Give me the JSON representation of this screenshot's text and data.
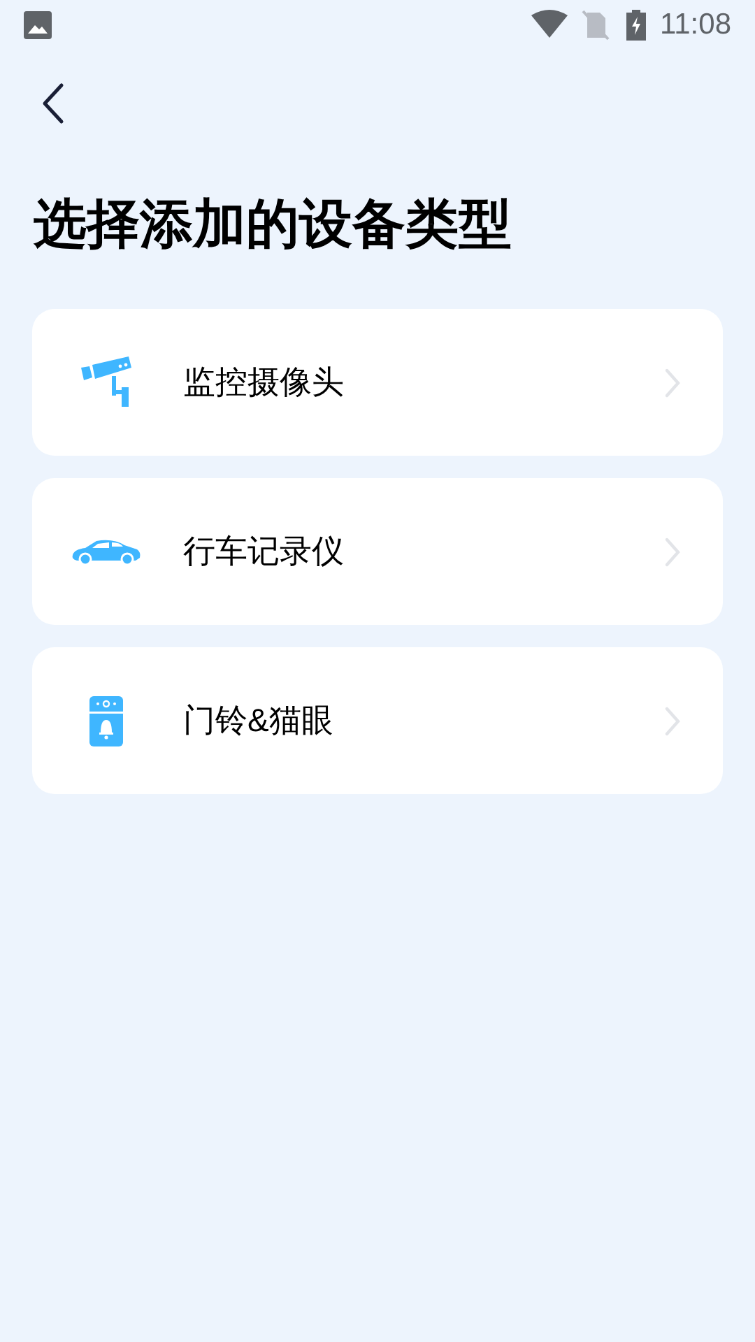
{
  "status_bar": {
    "time": "11:08"
  },
  "title": "选择添加的设备类型",
  "devices": [
    {
      "kind": "camera",
      "label": "监控摄像头"
    },
    {
      "kind": "car",
      "label": "行车记录仪"
    },
    {
      "kind": "doorbell",
      "label": "门铃&猫眼"
    }
  ]
}
